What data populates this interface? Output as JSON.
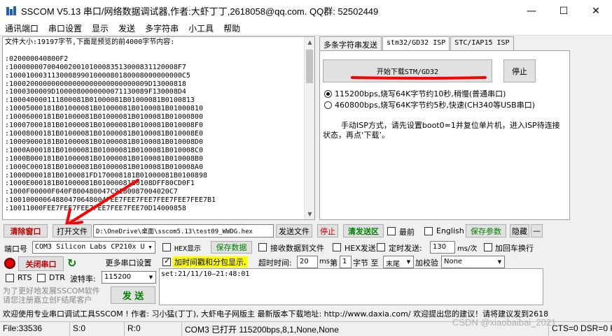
{
  "window": {
    "title": "SSCOM V5.13 串口/网络数据调试器,作者:大虾丁丁,2618058@qq.com. QQ群: 52502449",
    "minimize": "—",
    "maximize": "☐",
    "close": "✕"
  },
  "menu": [
    "通讯端口",
    "串口设置",
    "显示",
    "发送",
    "多字符串",
    "小工具",
    "帮助"
  ],
  "receive": {
    "header": "文件大小:19197字节,下面是预览的前4000字节内容:",
    "lines": [
      ":020000040800F2",
      ":1000000070040020010100083513000831120008F7",
      ":10001000311300089901000080180008000000000C5",
      ":100020000000000000000000000000009D13000818",
      ":1000300009D1000080000000071130089F130008D4",
      ":100040000111800081B01000081B01000081B0100813",
      ":10005000181B01000081B01000081B0100081B01000810",
      ":10006000181B01000081B01000081B0100081B01000800",
      ":10007000181B01000081B01000081B0100081B010008F0",
      ":10008000181B01000081B01000081B0100081B010008E0",
      ":10009000181B01000081B01000081B0100081B010008D0",
      ":1000A000181B01000081B01000081B0100081B010008C0",
      ":1000B000181B01000081B01000081B0100081B010008B0",
      ":1000C000181B01000081B01000081B0100081B010008A0",
      ":1000D000181B0100081FD170008181B01000081B0100898",
      ":1000E000181B01000081B01000081B0108DFF80CD0F1",
      ":1000F00000F040F800480047C9180087004020C7",
      ":10010000064880470648004FEE7FEE7FEE7FEE7FEE7FEE7B1",
      ":10011000FEE7FEE7FEE7FEE7FEE7FEE70D14000858"
    ]
  },
  "tabs": [
    "多条字符串发送",
    "stm32/GD32 ISP",
    "STC/IAP15 ISP"
  ],
  "isp": {
    "start_button": "开始下载STM/GD32",
    "stop_button": "停止",
    "opt1": "115200bps,烧写64K字节约10秒,稍慢(普通串口)",
    "opt2": "460800bps,烧写64K字节约5秒,快速(CH340等USB串口)",
    "info": "手动ISP方式，请先设置boot0=1并复位单片机，进入ISP待连接状态，再点‘下载’。"
  },
  "toolbar1": {
    "clear": "清除窗口",
    "open_file": "打开文件",
    "file_path": "D:\\OneDrive\\桌面\\sscom5.13\\test09_WWDG.hex",
    "send_file": "发送文件",
    "stop": "停止",
    "clear_send": "清发送区",
    "front": "最前",
    "english": "English",
    "save_params": "保存参数",
    "hide": "隐藏",
    "minus": "—"
  },
  "toolbar2": {
    "port_label": "端口号",
    "port_value": "COM3 Silicon Labs CP210x U",
    "hex_display": "HEX显示",
    "save_data": "保存数据",
    "recv_to_file": "接收数据到文件",
    "hex_send": "HEX发送",
    "timed_send": "定时发送:",
    "interval": "130",
    "interval_unit": "ms/次",
    "add_crlf": "加回车换行"
  },
  "toolbar3": {
    "close_port": "关闭串口",
    "more_settings": "更多串口设置",
    "add_timestamp": "加时间戳和分包显示,",
    "timeout_label": "超时时间:",
    "timeout": "20",
    "ms": "ms",
    "nth": "第",
    "byte_num": "1",
    "byte_label": "字节 至",
    "end_value": "末尾",
    "checksum_label": "加校验",
    "checksum_value": "None"
  },
  "toolbar4": {
    "rts": "RTS",
    "dtr": "DTR",
    "baud_label": "波特率:",
    "baud": "115200"
  },
  "promo": "为了更好地发展SSCOM软件\n请您注册嘉立创F结尾客户",
  "send_button": "发 送",
  "send_text": "set:21/11/10—21:48:01",
  "footer": "欢迎使用专业串口调试工具SSCOM !   作者: 习小猛(丁丁), 大虾电子网版主   最新版本下载地址: http://www.daxia.com/  欢迎提出您的建议！请将建议发到2618",
  "status": {
    "file": "File:33536",
    "s": "S:0",
    "r": "R:0",
    "port": "COM3 已打开  115200bps,8,1,None,None",
    "cts": "CTS=0 DSR=0 RLSD=0"
  },
  "watermark": "CSDN @xiaobaibai_2021",
  "colors": {
    "annotation": "#ff0000",
    "green": "#008000"
  }
}
